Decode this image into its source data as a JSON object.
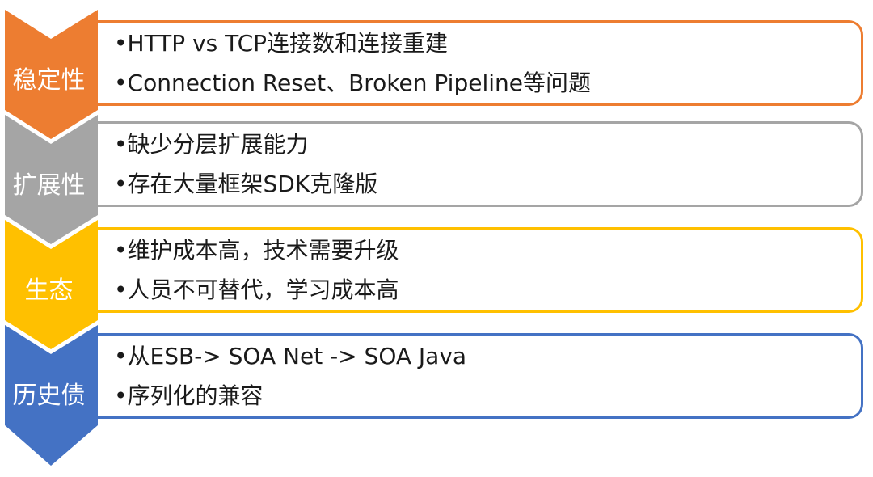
{
  "colors": {
    "stability": "#ED7D31",
    "extensibility": "#A5A5A5",
    "ecosystem": "#FFC000",
    "legacy": "#4472C4",
    "text": "#1a1a1a",
    "label_text": "#ffffff"
  },
  "rows": [
    {
      "label": "稳定性",
      "bullets": [
        "•HTTP vs TCP连接数和连接重建",
        "•Connection Reset、Broken Pipeline等问题"
      ]
    },
    {
      "label": "扩展性",
      "bullets": [
        "•缺少分层扩展能力",
        "•存在大量框架SDK克隆版"
      ]
    },
    {
      "label": "生态",
      "bullets": [
        "•维护成本高，技术需要升级",
        "•人员不可替代，学习成本高"
      ]
    },
    {
      "label": "历史债",
      "bullets": [
        "•从ESB-> SOA Net -> SOA Java",
        "•序列化的兼容"
      ]
    }
  ]
}
